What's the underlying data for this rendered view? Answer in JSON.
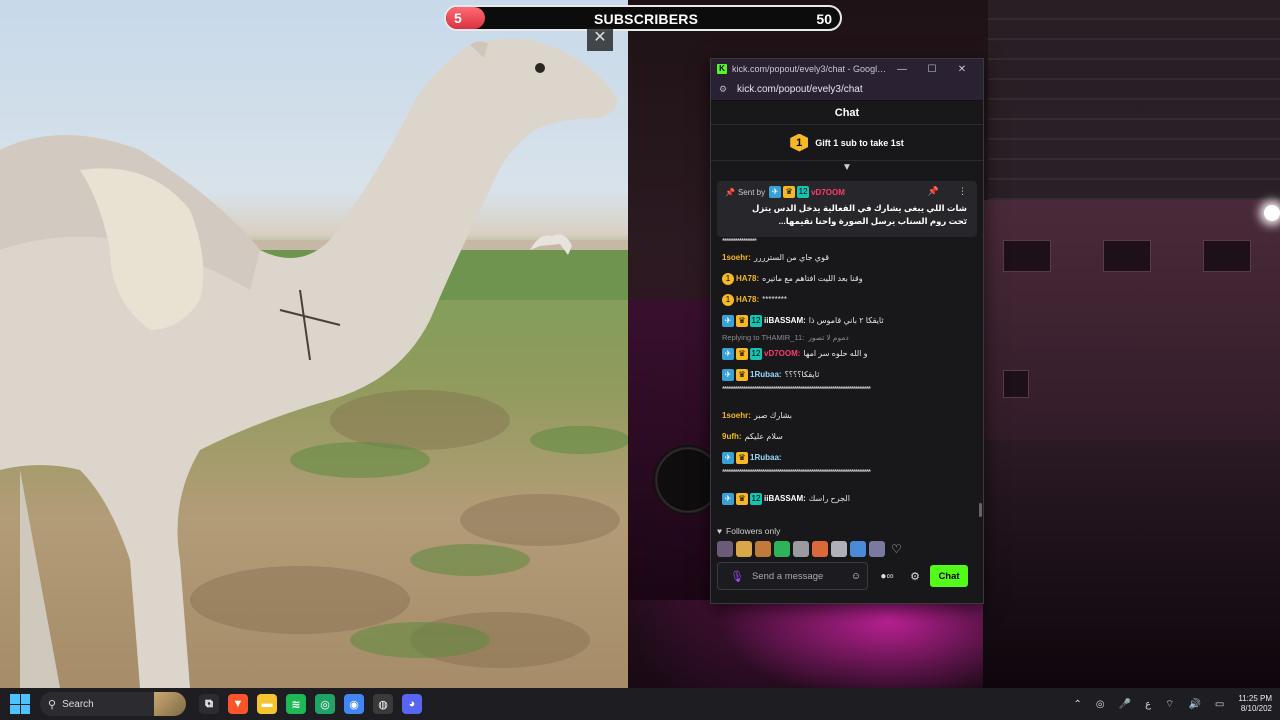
{
  "subscribers": {
    "current": "5",
    "label": "SUBSCRIBERS",
    "goal": "50",
    "progress_fraction": 0.1
  },
  "overlay": {
    "close_glyph": "✕"
  },
  "window": {
    "title": "kick.com/popout/evely3/chat - Google Chro...",
    "url": "kick.com/popout/evely3/chat",
    "controls": {
      "minimize": "—",
      "maximize": "☐",
      "close": "✕"
    }
  },
  "chat": {
    "header": "Chat",
    "gift": {
      "badge": "1",
      "text": "Gift 1 sub to take 1st"
    },
    "pinned": {
      "sent_by": "Sent by",
      "username": "vD7OOM",
      "username_color": "#ff3b6b",
      "text": "شات اللي يبغى يشارك في الفعالية يدخل الدس يتزل تحت روم السناب يرسل الصورة واحنا نقيمها..."
    },
    "separator_top": "****************",
    "messages": [
      {
        "user": "1soehr:",
        "color": "#f4b829",
        "badges": [],
        "text": "قوي جاي من السترررر"
      },
      {
        "user": "HA78:",
        "color": "#f4b829",
        "badges": [
          "coin"
        ],
        "text": "وقنا بعد الليت افتاهم مع ماتيره"
      },
      {
        "user": "HA78:",
        "color": "#f4b829",
        "badges": [
          "coin"
        ],
        "text": "********"
      },
      {
        "user": "iiBASSAM:",
        "color": "#ffffff",
        "badges": [
          "blue",
          "gold",
          "teal"
        ],
        "text": "ثايقكا ٢ باني قاموس ذا"
      },
      {
        "reply": "Replying to THAMIR_11:",
        "reply_text": "دموم لا تصور"
      },
      {
        "user": "vD7OOM:",
        "color": "#ff3b6b",
        "badges": [
          "blue",
          "gold",
          "teal"
        ],
        "text": "و الله حلوه سر امها"
      },
      {
        "user": "1Rubaa:",
        "color": "#9ad9ff",
        "badges": [
          "blue",
          "gold"
        ],
        "text": "ثايقكا؟؟؟؟"
      },
      {
        "long": "**********************************************************************"
      },
      {
        "user": "1soehr:",
        "color": "#f4b829",
        "badges": [],
        "text": "بشارك صبر"
      },
      {
        "user": "9ufh:",
        "color": "#f4b829",
        "badges": [],
        "text": "سلام عليكم"
      },
      {
        "user": "1Rubaa:",
        "color": "#9ad9ff",
        "badges": [
          "blue",
          "gold"
        ],
        "text": ""
      },
      {
        "long": "**********************************************************************"
      },
      {
        "user": "iiBASSAM:",
        "color": "#ffffff",
        "badges": [
          "blue",
          "gold",
          "teal"
        ],
        "text": "الجرح راسك"
      }
    ],
    "followers_only": "Followers only",
    "emote_colors": [
      "#6b5a7a",
      "#d9a64a",
      "#c27a3a",
      "#2fb35a",
      "#9a9aa0",
      "#d86a3a",
      "#b0b0b8",
      "#4a8ad8",
      "#7a7aa0"
    ],
    "input": {
      "placeholder": "Send a message"
    },
    "send_label": "Chat"
  },
  "taskbar": {
    "search_label": "Search",
    "apps": [
      {
        "name": "task-view-app",
        "glyph": "⧉",
        "color": "#2b2b30"
      },
      {
        "name": "brave-app",
        "glyph": "▼",
        "color": "#fb542b"
      },
      {
        "name": "file-explorer-app",
        "glyph": "▬",
        "color": "#f4c430"
      },
      {
        "name": "spotify-app",
        "glyph": "≋",
        "color": "#1db954"
      },
      {
        "name": "green-app",
        "glyph": "◎",
        "color": "#21a366"
      },
      {
        "name": "chrome-app",
        "glyph": "◉",
        "color": "#4285f4"
      },
      {
        "name": "obs-app",
        "glyph": "◍",
        "color": "#3a3a3a"
      },
      {
        "name": "discord-app",
        "glyph": "◕",
        "color": "#5865f2"
      }
    ],
    "tray": {
      "lang": "ع",
      "time": "11:25 PM",
      "date": "8/10/202"
    }
  }
}
